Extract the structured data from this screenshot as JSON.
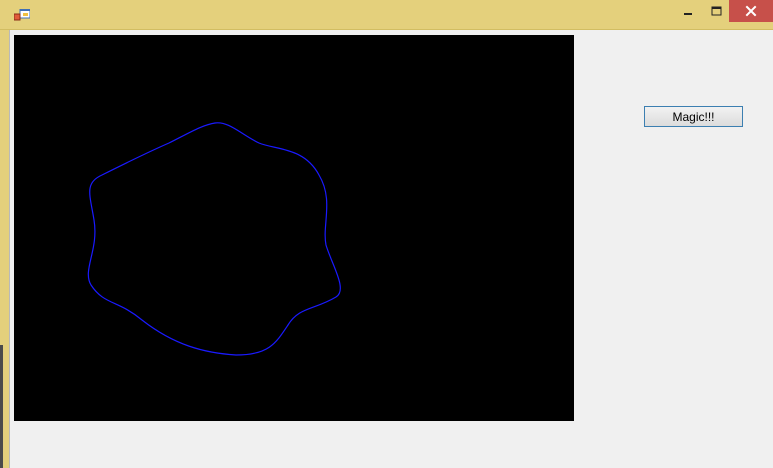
{
  "window": {
    "icon": "form-app-icon",
    "controls": {
      "minimize_icon": "minimize-icon",
      "maximize_icon": "maximize-icon",
      "close_icon": "close-icon"
    }
  },
  "canvas": {
    "background": "#000000",
    "curve_color": "#1a1aff",
    "curve_description_icon": "wobbly-blob-curve"
  },
  "actions": {
    "magic_label": "Magic!!!"
  },
  "colors": {
    "titlebar": "#e4d07c",
    "close_button": "#c7504a",
    "client_background": "#f0f0f0",
    "button_border": "#3c7fb1"
  }
}
